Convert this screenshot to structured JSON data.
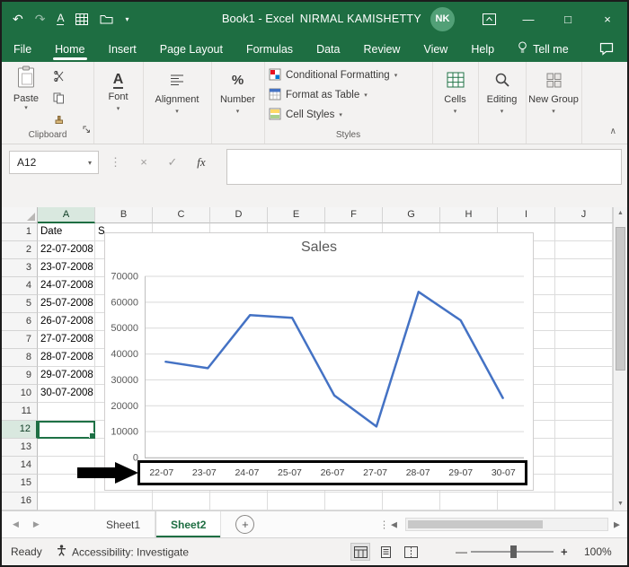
{
  "title_bar": {
    "title": "Book1 - Excel",
    "user_name": "NIRMAL KAMISHETTY",
    "avatar_initials": "NK"
  },
  "tabs": [
    {
      "label": "File"
    },
    {
      "label": "Home",
      "active": true
    },
    {
      "label": "Insert"
    },
    {
      "label": "Page Layout"
    },
    {
      "label": "Formulas"
    },
    {
      "label": "Data"
    },
    {
      "label": "Review"
    },
    {
      "label": "View"
    },
    {
      "label": "Help"
    },
    {
      "label": "Tell me"
    }
  ],
  "ribbon": {
    "paste": "Paste",
    "clipboard_group": "Clipboard",
    "font_group": "Font",
    "alignment_group": "Alignment",
    "number_group": "Number",
    "conditional_formatting": "Conditional Formatting",
    "format_as_table": "Format as Table",
    "cell_styles": "Cell Styles",
    "styles_group": "Styles",
    "cells_group": "Cells",
    "editing_group": "Editing",
    "new_group": "New Group"
  },
  "formula_bar": {
    "name_box": "A12",
    "fx": "fx",
    "value": ""
  },
  "grid": {
    "columns": [
      "A",
      "B",
      "C",
      "D",
      "E",
      "F",
      "G",
      "H",
      "I",
      "J"
    ],
    "row_count": 16,
    "selected_cell": "A12",
    "cells": {
      "A1": "Date",
      "B1": "S",
      "A2": "22-07-2008",
      "A3": "23-07-2008",
      "A4": "24-07-2008",
      "A5": "25-07-2008",
      "A6": "26-07-2008",
      "A7": "27-07-2008",
      "A8": "28-07-2008",
      "A9": "29-07-2008",
      "A10": "30-07-2008"
    }
  },
  "chart_data": {
    "type": "line",
    "title": "Sales",
    "categories": [
      "22-07",
      "23-07",
      "24-07",
      "25-07",
      "26-07",
      "27-07",
      "28-07",
      "29-07",
      "30-07"
    ],
    "values": [
      37000,
      34500,
      55000,
      54000,
      24000,
      12000,
      64000,
      53000,
      23000
    ],
    "ylim": [
      0,
      70000
    ],
    "yticks": [
      0,
      10000,
      20000,
      30000,
      40000,
      50000,
      60000,
      70000
    ],
    "line_color": "#4472c4",
    "grid": true,
    "legend": "none",
    "xaxis_highlighted": true
  },
  "sheet_bar": {
    "tabs": [
      {
        "label": "Sheet1"
      },
      {
        "label": "Sheet2",
        "active": true
      }
    ],
    "add": "+"
  },
  "status_bar": {
    "mode": "Ready",
    "accessibility": "Accessibility: Investigate",
    "zoom": "100%"
  },
  "icons": {
    "undo": "↶",
    "redo": "↷",
    "underline_letter": "A",
    "qat_dropdown": "▾",
    "minimize": "—",
    "maximize": "□",
    "close": "×",
    "dropdown": "▾",
    "collapse_ribbon": "∧",
    "cancel": "×",
    "enter": "✓",
    "dots": "⋮",
    "percent": "%",
    "scroll_up": "▲",
    "scroll_down": "▼",
    "scroll_left": "◀",
    "scroll_right": "▶",
    "zoom_out": "—",
    "zoom_in": "+"
  },
  "colors": {
    "excel_green": "#1e6e42",
    "chart_line": "#4472c4",
    "highlight_box": "#000000"
  }
}
